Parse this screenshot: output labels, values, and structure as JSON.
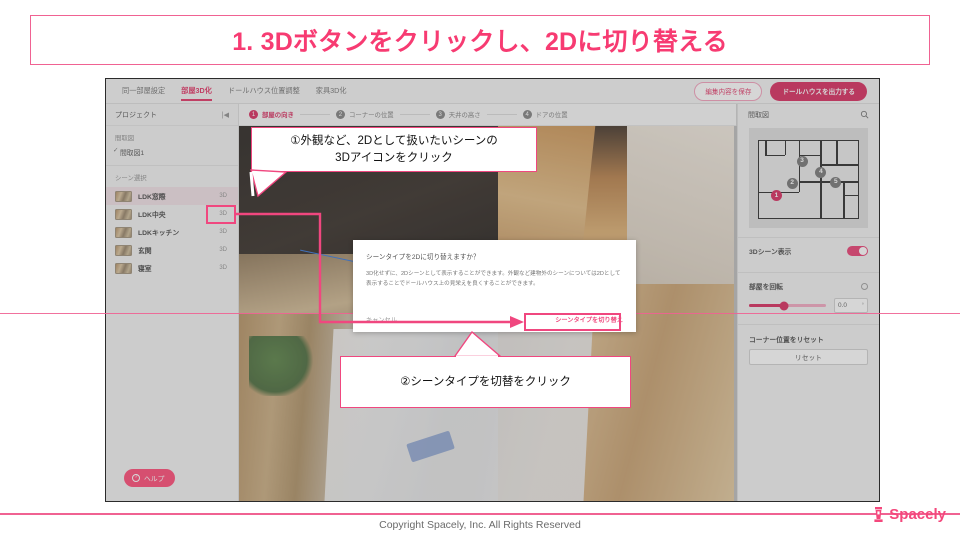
{
  "slide": {
    "title": "1. 3Dボタンをクリックし、2Dに切り替える",
    "accent": "#f0477f",
    "footer_text": "Copyright Spacely, Inc. All Rights Reserved",
    "logo_text": "Spacely"
  },
  "app": {
    "tabs": [
      {
        "label": "同一部屋設定",
        "active": false
      },
      {
        "label": "部屋3D化",
        "active": true
      },
      {
        "label": "ドールハウス位置調整",
        "active": false
      },
      {
        "label": "家具3D化",
        "active": false
      }
    ],
    "actions": {
      "save_label": "編集内容を保存",
      "export_label": "ドールハウスを出力する"
    },
    "steps": [
      {
        "num": "1",
        "label": "部屋の向き",
        "active": true
      },
      {
        "num": "2",
        "label": "コーナーの位置",
        "active": false
      },
      {
        "num": "3",
        "label": "天井の高さ",
        "active": false
      },
      {
        "num": "4",
        "label": "ドアの位置",
        "active": false
      }
    ]
  },
  "sidebar": {
    "header_label": "プロジェクト",
    "collapse_icon": "|◀",
    "plan_section_label": "間取図",
    "plan_item": "間取図1",
    "plan_check": "✓",
    "scene_section_label": "シーン選択",
    "scenes": [
      {
        "name": "LDK窓際",
        "badge": "3D",
        "selected": true
      },
      {
        "name": "LDK中央",
        "badge": "3D",
        "selected": false
      },
      {
        "name": "LDKキッチン",
        "badge": "3D",
        "selected": false
      },
      {
        "name": "玄関",
        "badge": "3D",
        "selected": false
      },
      {
        "name": "寝室",
        "badge": "3D",
        "selected": false
      }
    ],
    "help_label": "ヘルプ",
    "help_icon": "?"
  },
  "right_panel": {
    "header_label": "間取図",
    "search_icon": "search-icon",
    "markers": [
      {
        "num": "1",
        "active": true,
        "x": 12,
        "y": 64
      },
      {
        "num": "2",
        "active": false,
        "x": 28,
        "y": 48
      },
      {
        "num": "3",
        "active": false,
        "x": 38,
        "y": 19
      },
      {
        "num": "4",
        "active": false,
        "x": 57,
        "y": 34
      },
      {
        "num": "5",
        "active": false,
        "x": 72,
        "y": 47
      }
    ],
    "scene_display_label": "3Dシーン表示",
    "scene_display_on": true,
    "rotate_label": "部屋を回転",
    "rotate_value": "0.0",
    "rotate_unit": "°",
    "rotate_percent": 45,
    "corner_reset_label": "コーナー位置をリセット",
    "reset_button_label": "リセット"
  },
  "dialog": {
    "title": "シーンタイプを2Dに切り替えますか？",
    "body": "3D化せずに、2Dシーンとして表示することができます。外観など建物外のシーンについては2Dとして表示することでドールハウス上の見栄えを良くすることができます。",
    "cancel_label": "キャンセル",
    "confirm_label": "シーンタイプを切り替え"
  },
  "annotations": {
    "callout_1": "①外観など、2Dとして扱いたいシーンの\n3Dアイコンをクリック",
    "callout_1_line1": "①外観など、2Dとして扱いたいシーンの",
    "callout_1_line2": "3Dアイコンをクリック",
    "callout_2": "②シーンタイプを切替をクリック"
  }
}
